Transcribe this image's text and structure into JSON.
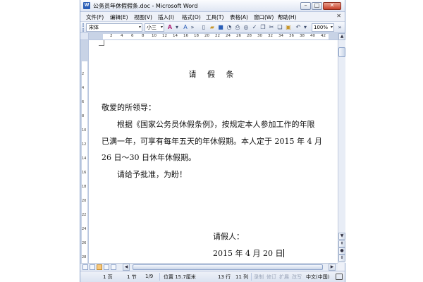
{
  "window": {
    "title": "公务员年休假假条.doc - Microsoft Word",
    "app_icon": "W"
  },
  "menu": [
    {
      "label": "文件(F)"
    },
    {
      "label": "编辑(E)"
    },
    {
      "label": "视图(V)"
    },
    {
      "label": "插入(I)"
    },
    {
      "label": "格式(O)"
    },
    {
      "label": "工具(T)"
    },
    {
      "label": "表格(A)"
    },
    {
      "label": "窗口(W)"
    },
    {
      "label": "帮助(H)"
    }
  ],
  "toolbar": {
    "font_name": "宋体",
    "font_size": "小三",
    "zoom": "100%"
  },
  "ruler": {
    "h_labels": [
      "2",
      "4",
      "6",
      "8",
      "10",
      "12",
      "14",
      "16",
      "18",
      "20",
      "22",
      "24",
      "26",
      "28",
      "30",
      "32",
      "34",
      "36",
      "38",
      "40",
      "42"
    ],
    "v_labels": [
      "2",
      "4",
      "6",
      "8",
      "10",
      "12",
      "14",
      "16",
      "18",
      "20",
      "22",
      "24",
      "26",
      "28"
    ]
  },
  "document": {
    "title": "请  假  条",
    "salutation": "敬爱的所领导：",
    "body_line1": "根据《国家公务员休假条例》，按规定本人参加工作的年限",
    "body_line2": "已满一年，可享有每年五天的年休假期。本人定于 2015 年 4 月",
    "body_line3": "26 日～30 日休年休假期。",
    "request": "请给予批准，为盼！",
    "signature": "请假人：",
    "date": "2015 年 4 月 20 日"
  },
  "status": {
    "page": "1 页",
    "section": "1 节",
    "page_of": "1/9",
    "position": "位置 15.7厘米",
    "line": "13 行",
    "column": "11 列",
    "rec": "录制",
    "trk": "修订",
    "ext": "扩展",
    "ovr": "改写",
    "language": "中文(中国)"
  },
  "colors": {
    "accent": "#2b5fb8",
    "chrome": "#eef1f8",
    "ruler": "#c8d3e6"
  }
}
